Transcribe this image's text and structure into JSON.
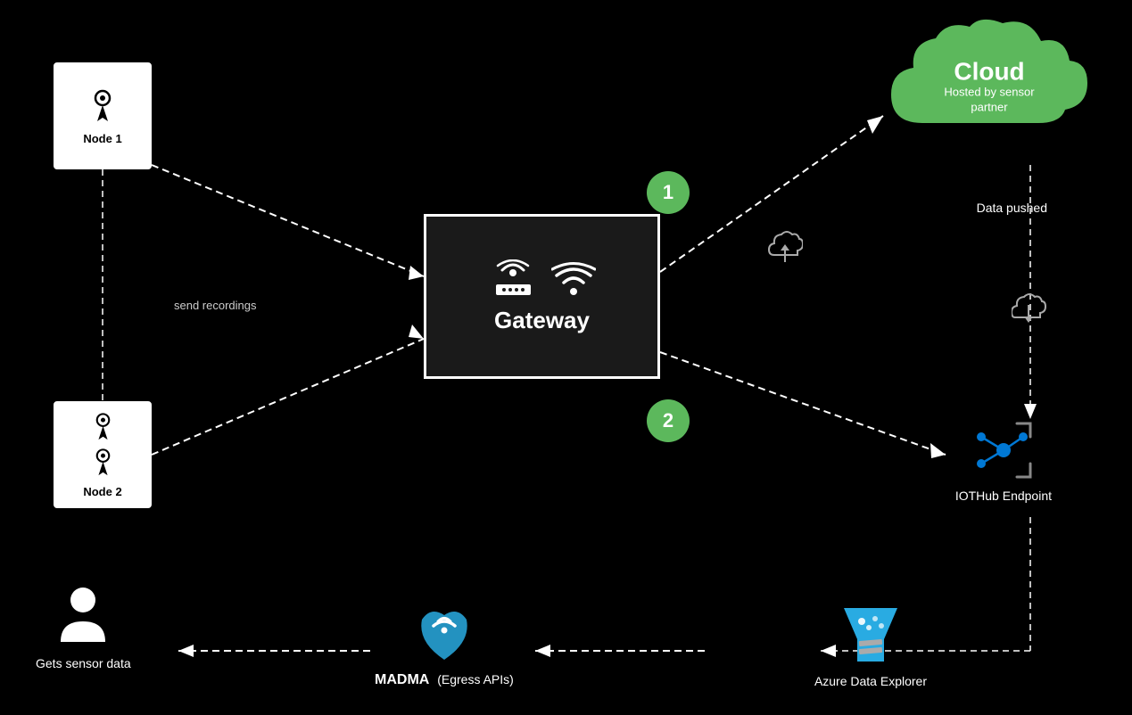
{
  "cloud": {
    "title": "Cloud",
    "subtitle": "Hosted by sensor partner"
  },
  "node1": {
    "label": "Node 1"
  },
  "node2": {
    "label": "Node 2"
  },
  "gateway": {
    "label": "Gateway"
  },
  "circle1": {
    "number": "1"
  },
  "circle2": {
    "number": "2"
  },
  "iothub": {
    "label": "IOTHub Endpoint"
  },
  "data_pushed": "Data pushed",
  "send_recordings": "send recordings",
  "madma": {
    "label": "MADMA",
    "sublabel": "(Egress APIs)"
  },
  "azure": {
    "label": "Azure Data Explorer"
  },
  "user": {
    "label": "Gets sensor data"
  }
}
